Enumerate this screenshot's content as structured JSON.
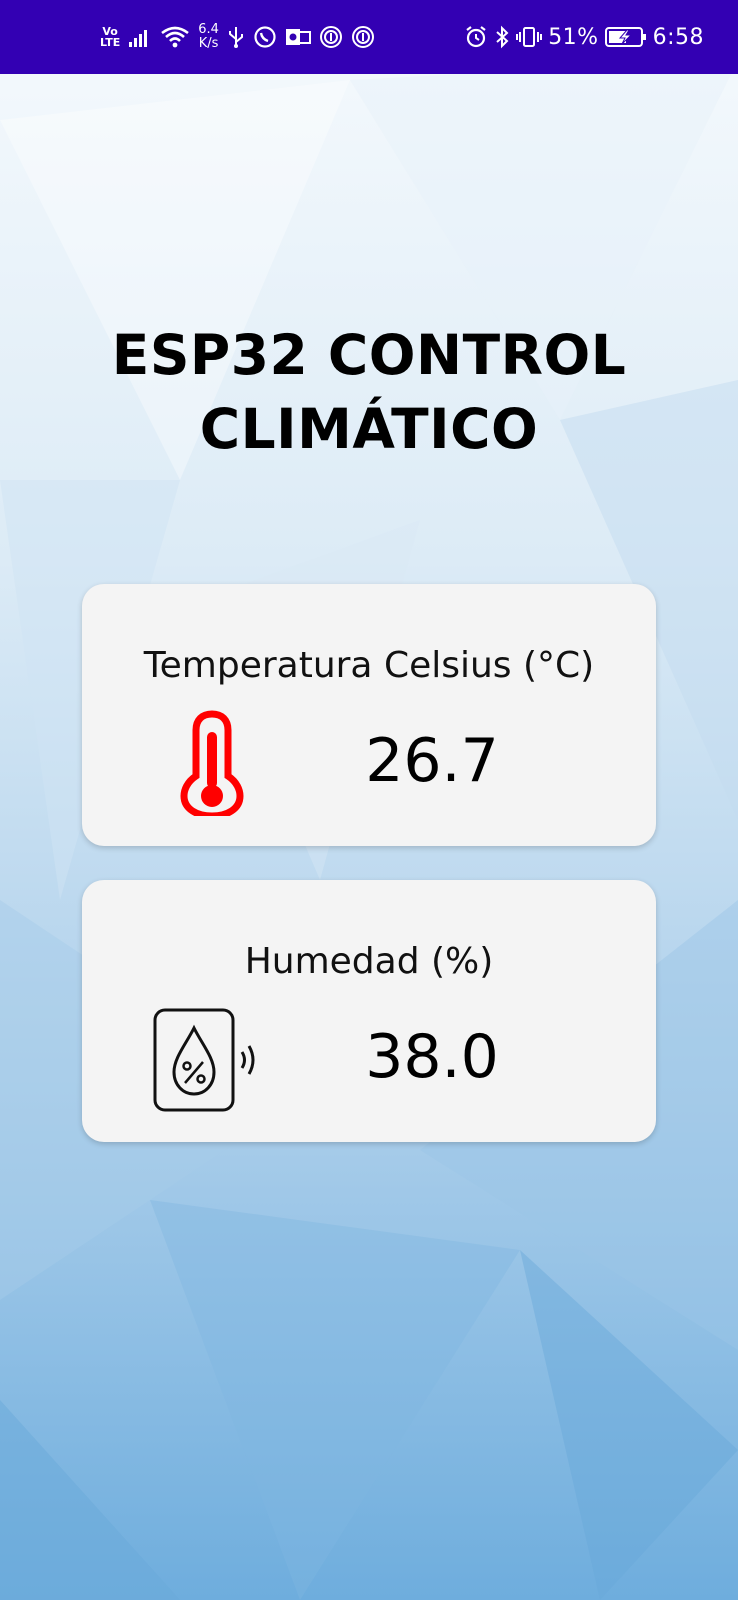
{
  "status_bar": {
    "volte_top": "Vo",
    "volte_bottom": "LTE",
    "net_speed_value": "6.4",
    "net_speed_unit": "K/s",
    "battery_percent": "51%",
    "time": "6:58",
    "left_icons": [
      "signal-icon",
      "wifi-icon",
      "usb-icon",
      "whatsapp-icon",
      "outlook-icon",
      "nfc-icon",
      "nfc-icon"
    ],
    "right_icons": [
      "alarm-icon",
      "bluetooth-icon",
      "vibrate-icon",
      "battery-charging-icon"
    ]
  },
  "app": {
    "title_line1": "ESP32 CONTROL",
    "title_line2": "CLIMÁTICO"
  },
  "cards": [
    {
      "label": "Temperatura Celsius (°C)",
      "value": "26.7",
      "icon": "thermometer-icon",
      "icon_color": "#ff0000"
    },
    {
      "label": "Humedad (%)",
      "value": "38.0",
      "icon": "humidity-sensor-icon",
      "icon_color": "#111111"
    }
  ],
  "colors": {
    "status_bar": "#3300b3",
    "card_background": "#f4f4f4",
    "background_top": "#f4f9fd",
    "background_bottom": "#6faede"
  }
}
